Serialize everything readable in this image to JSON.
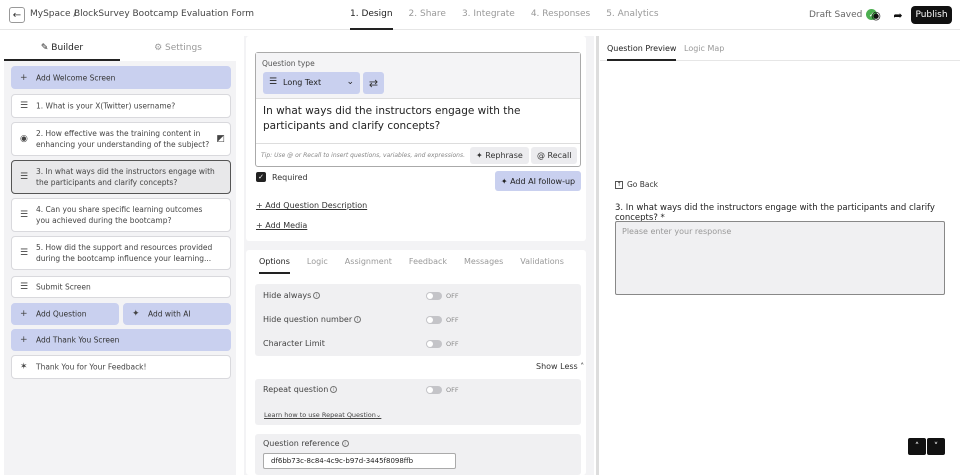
{
  "header": {
    "back_icon": "arrow-left-icon",
    "breadcrumb_root": "MySpace /",
    "form_title": "BlockSurvey Bootcamp Evaluation Form",
    "steps": [
      "1. Design",
      "2. Share",
      "3. Integrate",
      "4. Responses",
      "5. Analytics"
    ],
    "active_step": "1. Design",
    "save_status": "Draft Saved",
    "publish_label": "Publish"
  },
  "sidebar": {
    "tabs": [
      "Builder",
      "Settings"
    ],
    "active_tab": "Builder",
    "welcome_label": "Add Welcome Screen",
    "questions": [
      "1. What is your X(Twitter) username?",
      "2. How effective was the training content in enhancing your understanding of the subject?",
      "3. In what ways did the instructors engage with the participants and clarify concepts?",
      "4. Can you share specific learning outcomes you achieved during the bootcamp?",
      "5. How did the support and resources provided during the bootcamp influence your learning..."
    ],
    "submit_label": "Submit Screen",
    "add_question_label": "Add Question",
    "add_ai_label": "Add with AI",
    "add_thankyou_label": "Add Thank You Screen",
    "thankyou_label": "Thank You for Your Feedback!"
  },
  "editor": {
    "question_type_label": "Question type",
    "question_type_value": "Long Text",
    "question_text": "In what ways did the instructors engage with the participants and clarify concepts?",
    "tip": "Tip: Use @ or Recall to insert questions, variables, and expressions.",
    "rephrase_label": "Rephrase",
    "recall_label": "Recall",
    "required_label": "Required",
    "ai_followup_label": "Add AI follow-up",
    "add_description_label": "+ Add Question Description",
    "add_media_label": "+ Add Media"
  },
  "options": {
    "tabs": [
      "Options",
      "Logic",
      "Assignment",
      "Feedback",
      "Messages",
      "Validations"
    ],
    "active_tab": "Options",
    "hide_always": "Hide always",
    "hide_number": "Hide question number",
    "char_limit": "Character Limit",
    "off_label": "OFF",
    "show_less": "Show Less",
    "repeat_question": "Repeat question",
    "learn_repeat": "Learn how to use Repeat Question",
    "question_reference_label": "Question reference",
    "question_reference_value": "df6bb73c-8c84-4c9c-b97d-3445f8098ffb"
  },
  "preview": {
    "tabs": [
      "Question Preview",
      "Logic Map"
    ],
    "active_tab": "Question Preview",
    "go_back": "Go Back",
    "question": "3. In what ways did the instructors engage with the participants and clarify concepts? *",
    "placeholder": "Please enter your response"
  }
}
